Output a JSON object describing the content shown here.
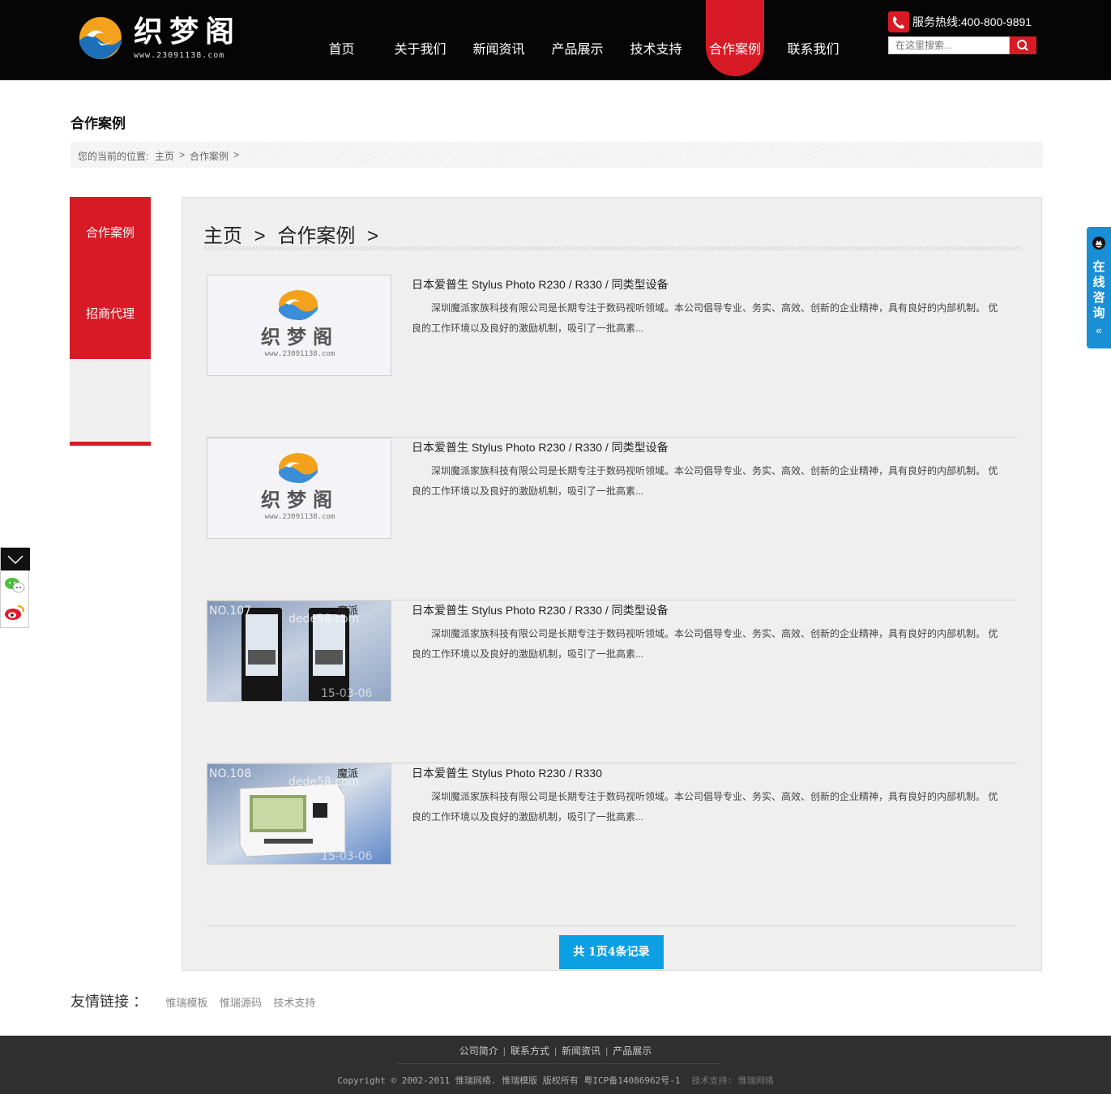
{
  "header": {
    "logo_text": "织梦阁",
    "logo_url": "www.23091138.com",
    "nav": [
      {
        "label": "首页"
      },
      {
        "label": "关于我们"
      },
      {
        "label": "新闻资讯"
      },
      {
        "label": "产品展示"
      },
      {
        "label": "技术支持"
      },
      {
        "label": "合作案例",
        "active": true
      },
      {
        "label": "联系我们"
      }
    ],
    "hotline": "服务热线:400-800-9891",
    "search_placeholder": "在这里搜索..."
  },
  "page": {
    "title": "合作案例",
    "breadcrumb": {
      "prefix": "您的当前的位置:",
      "home": "主页",
      "current": "合作案例",
      "sep": ">"
    }
  },
  "sidebar": {
    "items": [
      {
        "label": "合作案例"
      },
      {
        "label": "招商代理"
      }
    ]
  },
  "main": {
    "crumb": {
      "home": "主页",
      "sep": ">",
      "current": "合作案例"
    },
    "cases": [
      {
        "title": "日本爱普生 Stylus Photo R230 / R330 / 同类型设备",
        "desc": "深圳魔派家族科技有限公司是长期专注于数码视听领域。本公司倡导专业、务实、高效、创新的企业精神，具有良好的内部机制。 优良的工作环境以及良好的激励机制，吸引了一批高素...",
        "thumb": {
          "type": "logo",
          "logo_text": "织梦阁",
          "url": "www.23091138.com"
        }
      },
      {
        "title": "日本爱普生 Stylus Photo R230 / R330 / 同类型设备",
        "desc": "深圳魔派家族科技有限公司是长期专注于数码视听领域。本公司倡导专业、务实、高效、创新的企业精神，具有良好的内部机制。 优良的工作环境以及良好的激励机制，吸引了一批高素...",
        "thumb": {
          "type": "logo",
          "logo_text": "织梦阁",
          "url": "www.23091138.com"
        }
      },
      {
        "title": "日本爱普生 Stylus Photo R230 / R330 / 同类型设备",
        "desc": "深圳魔派家族科技有限公司是长期专注于数码视听领域。本公司倡导专业、务实、高效、创新的企业精神，具有良好的内部机制。 优良的工作环境以及良好的激励机制，吸引了一批高素...",
        "thumb": {
          "type": "kiosk",
          "no": "NO.107",
          "brand": "魔派",
          "site": "dede58.com",
          "date": "15-03-06"
        }
      },
      {
        "title": "日本爱普生 Stylus Photo R230 / R330",
        "desc": "深圳魔派家族科技有限公司是长期专注于数码视听领域。本公司倡导专业、务实、高效、创新的企业精神，具有良好的内部机制。 优良的工作环境以及良好的激励机制，吸引了一批高素...",
        "thumb": {
          "type": "printer",
          "no": "NO.108",
          "brand": "魔派",
          "site": "dede58.com",
          "date": "15-03-06"
        }
      }
    ],
    "pager": "共 1页4条记录"
  },
  "links": {
    "label": "友情链接 ：",
    "items": [
      "惟瑞模板",
      "惟瑞源码",
      "技术支持"
    ]
  },
  "footer": {
    "nav": [
      "公司简介",
      "联系方式",
      "新闻资讯",
      "产品展示"
    ],
    "sep": "|",
    "copyright": "Copyright © 2002-2011 惟瑞网络. 惟瑞模版 版权所有 粤ICP备14086962号-1",
    "support": "技术支持: 惟瑞网络"
  },
  "consult": {
    "label": "在线咨询",
    "arrow": "«"
  },
  "colors": {
    "brand_red": "#d71a26",
    "header_bg": "#050505",
    "accent_blue": "#0ba0e3",
    "consult_blue": "#1a8fd6"
  },
  "icons": [
    "phone-icon",
    "search-icon",
    "qq-icon",
    "chevron-down-icon",
    "wechat-icon",
    "weibo-icon"
  ]
}
